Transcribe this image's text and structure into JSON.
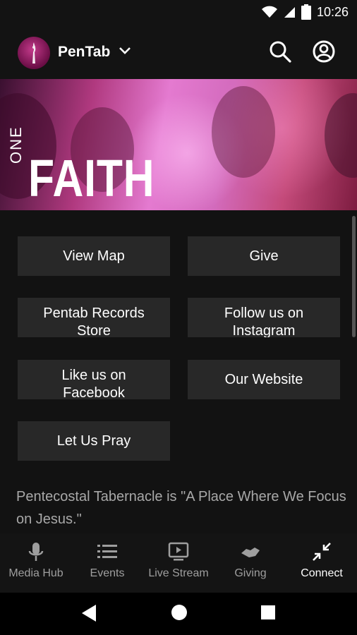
{
  "status_bar": {
    "time": "10:26"
  },
  "app_bar": {
    "title": "PenTab"
  },
  "banner": {
    "line1": "ONE",
    "line2": "FAITH"
  },
  "actions": [
    {
      "label": "View Map"
    },
    {
      "label": "Give"
    },
    {
      "label_line1": "Pentab Records",
      "label_line2": "Store"
    },
    {
      "label_line1": "Follow us on",
      "label_line2": "Instagram"
    },
    {
      "label_line1": "Like us on",
      "label_line2": "Facebook"
    },
    {
      "label": "Our Website"
    },
    {
      "label": "Let Us Pray"
    }
  ],
  "description": "Pentecostal Tabernacle is \"A Place Where We Focus on Jesus.\"",
  "bottom_nav": [
    {
      "label": "Media Hub",
      "icon": "microphone-icon"
    },
    {
      "label": "Events",
      "icon": "list-icon"
    },
    {
      "label": "Live Stream",
      "icon": "tv-play-icon"
    },
    {
      "label": "Giving",
      "icon": "handshake-icon"
    },
    {
      "label": "Connect",
      "icon": "collapse-arrows-icon",
      "active": true
    }
  ],
  "colors": {
    "background": "#121212",
    "button": "#282828",
    "banner_accent": "#d36bbd",
    "inactive_text": "#9e9e9e",
    "active_text": "#ffffff"
  }
}
